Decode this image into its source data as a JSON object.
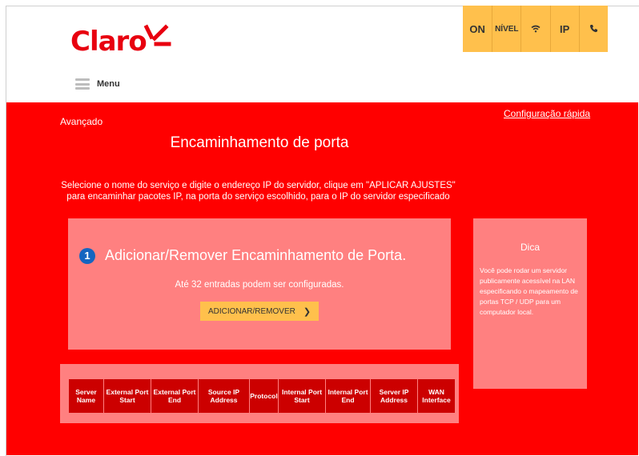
{
  "brand": {
    "logo_text": "Claro",
    "accent": "#e8000f",
    "status_color": "#ffc04c"
  },
  "status_bar": {
    "items": [
      {
        "label": "ON",
        "icon": ""
      },
      {
        "label": "NÍVEL",
        "icon": ""
      },
      {
        "label": "",
        "icon": "wifi-icon"
      },
      {
        "label": "IP",
        "icon": ""
      },
      {
        "label": "",
        "icon": "phone-icon"
      }
    ]
  },
  "menu": {
    "label": "Menu",
    "icon": "hamburger-icon"
  },
  "breadcrumb": "Avançado",
  "quick_config": "Configuração rápida",
  "page_title": "Encaminhamento de porta",
  "description": "Selecione o nome do serviço e digite o endereço IP do servidor, clique em \"APLICAR AJUSTES\" para encaminhar pacotes IP, na porta do serviço escolhido, para o IP do servidor especificado",
  "section": {
    "step": "1",
    "title": "Adicionar/Remover Encaminhamento de Porta.",
    "subtitle": "Até 32 entradas podem ser configuradas.",
    "button_label": "ADICIONAR/REMOVER",
    "button_icon": "chevron-right-icon"
  },
  "tip": {
    "title": "Dica",
    "text": "Você pode rodar um servidor publicamente acessível na LAN especificando o mapeamento de portas TCP / UDP para um computador local."
  },
  "table": {
    "headers": [
      "Server Name",
      "External Port Start",
      "External Port End",
      "Source IP Address",
      "Protocol",
      "Internal Port Start",
      "Internal Port End",
      "Server IP Address",
      "WAN Interface"
    ]
  }
}
